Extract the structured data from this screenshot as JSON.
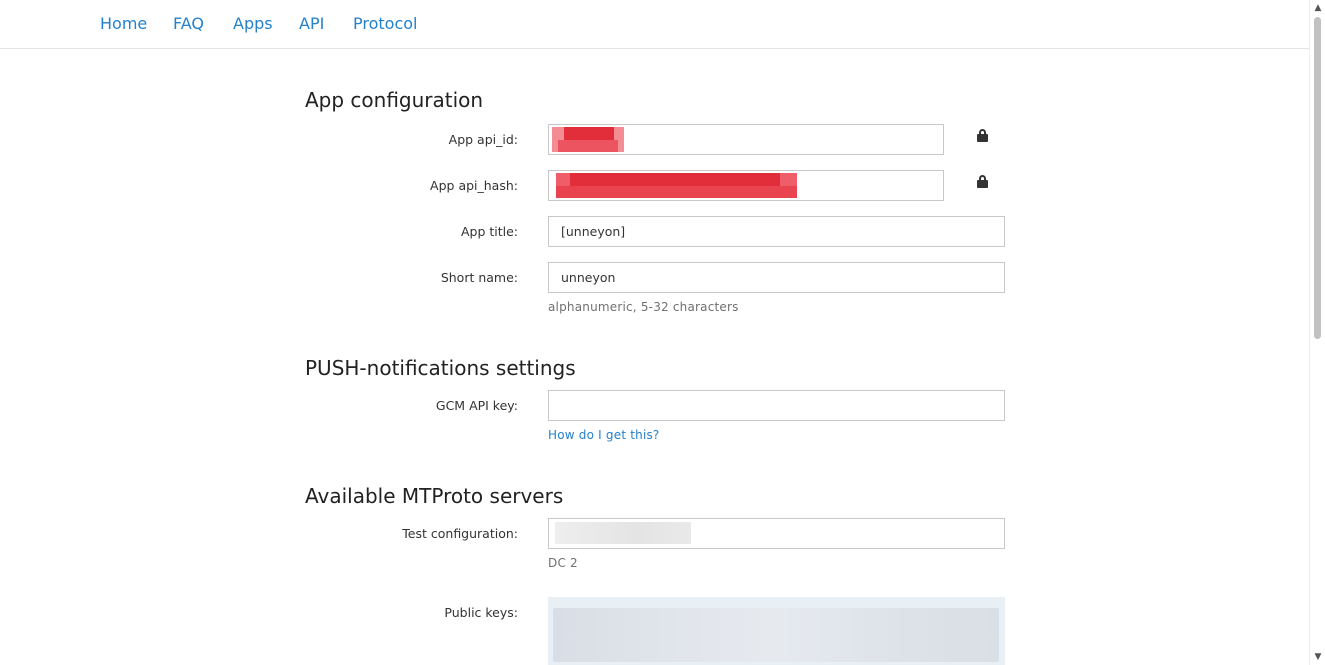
{
  "nav": {
    "items": [
      {
        "label": "Home"
      },
      {
        "label": "FAQ"
      },
      {
        "label": "Apps"
      },
      {
        "label": "API"
      },
      {
        "label": "Protocol"
      }
    ]
  },
  "sections": {
    "app_config": {
      "heading": "App configuration",
      "api_id_label": "App api_id:",
      "api_hash_label": "App api_hash:",
      "title_label": "App title:",
      "title_value": "[unneyon]",
      "short_name_label": "Short name:",
      "short_name_value": "unneyon",
      "short_name_hint": "alphanumeric, 5-32 characters"
    },
    "push": {
      "heading": "PUSH-notifications settings",
      "gcm_label": "GCM API key:",
      "gcm_value": "",
      "help_link": "How do I get this?"
    },
    "servers": {
      "heading": "Available MTProto servers",
      "test_config_label": "Test configuration:",
      "test_config_dc": "DC 2",
      "public_keys_label": "Public keys:"
    }
  },
  "icons": {
    "lock": "lock-icon"
  },
  "colors": {
    "link": "#2481cc",
    "redaction": "#e53946"
  }
}
